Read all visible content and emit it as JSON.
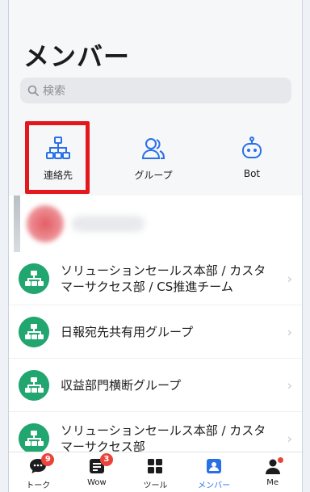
{
  "page": {
    "title": "メンバー"
  },
  "search": {
    "placeholder": "検索"
  },
  "shortcuts": [
    {
      "label": "連絡先",
      "icon": "org-chart-icon"
    },
    {
      "label": "グループ",
      "icon": "group-icon"
    },
    {
      "label": "Bot",
      "icon": "bot-icon"
    }
  ],
  "groups": [
    {
      "name": "ソリューションセールス本部 / カスタマーサクセス部 / CS推進チーム"
    },
    {
      "name": "日報宛先共有用グループ"
    },
    {
      "name": "収益部門横断グループ"
    },
    {
      "name": "ソリューションセールス本部 / カスタマーサクセス部"
    }
  ],
  "tabbar": [
    {
      "label": "トーク",
      "badge": "9"
    },
    {
      "label": "Wow",
      "badge": "3"
    },
    {
      "label": "ツール",
      "badge": ""
    },
    {
      "label": "メンバー",
      "badge": ""
    },
    {
      "label": "Me",
      "badge": ""
    }
  ],
  "colors": {
    "accent": "#2970e8",
    "group_avatar": "#21a66f",
    "badge": "#e9443b",
    "highlight": "#e3171c"
  }
}
